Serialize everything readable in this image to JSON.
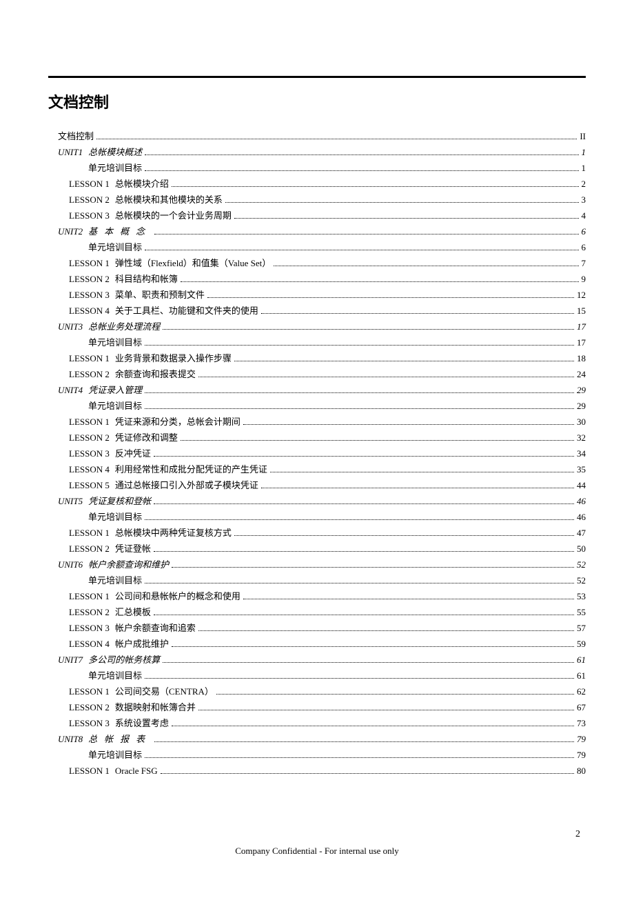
{
  "title": "文档控制",
  "footer": "Company Confidential - For internal use only",
  "page_number": "2",
  "toc": [
    {
      "level": 0,
      "label": "",
      "text": "文档控制",
      "page": "II"
    },
    {
      "level": 1,
      "label": "UNIT1",
      "text": "总帐模块概述",
      "page": "1"
    },
    {
      "level": 2,
      "label": "",
      "text": "单元培训目标",
      "page": "1"
    },
    {
      "level": 3,
      "label": "LESSON 1",
      "text": "总帐模块介绍",
      "page": "2"
    },
    {
      "level": 3,
      "label": "LESSON 2",
      "text": "总帐模块和其他模块的关系",
      "page": "3"
    },
    {
      "level": 3,
      "label": "LESSON 3",
      "text": "总帐模块的一个会计业务周期",
      "page": "4"
    },
    {
      "level": 1,
      "label": "UNIT2",
      "text": "基本概念",
      "page": "6",
      "spaced": true
    },
    {
      "level": 2,
      "label": "",
      "text": "单元培训目标",
      "page": "6"
    },
    {
      "level": 3,
      "label": "LESSON 1",
      "text": "弹性域（Flexfield）和值集（Value Set）",
      "page": "7"
    },
    {
      "level": 3,
      "label": "LESSON 2",
      "text": "科目结构和帐簿",
      "page": "9"
    },
    {
      "level": 3,
      "label": "LESSON 3",
      "text": "菜单、职责和预制文件",
      "page": "12"
    },
    {
      "level": 3,
      "label": "LESSON 4",
      "text": "关于工具栏、功能键和文件夹的使用",
      "page": "15"
    },
    {
      "level": 1,
      "label": "UNIT3",
      "text": "总帐业务处理流程",
      "page": "17"
    },
    {
      "level": 2,
      "label": "",
      "text": "单元培训目标",
      "page": "17"
    },
    {
      "level": 3,
      "label": "LESSON 1",
      "text": "业务背景和数据录入操作步骤",
      "page": "18"
    },
    {
      "level": 3,
      "label": "LESSON 2",
      "text": "余额查询和报表提交",
      "page": "24"
    },
    {
      "level": 1,
      "label": "UNIT4",
      "text": "凭证录入管理",
      "page": "29"
    },
    {
      "level": 2,
      "label": "",
      "text": "单元培训目标",
      "page": "29"
    },
    {
      "level": 3,
      "label": "LESSON 1",
      "text": "凭证来源和分类，总帐会计期间",
      "page": "30"
    },
    {
      "level": 3,
      "label": "LESSON 2",
      "text": "凭证修改和调整",
      "page": "32"
    },
    {
      "level": 3,
      "label": "LESSON 3",
      "text": "反冲凭证",
      "page": "34"
    },
    {
      "level": 3,
      "label": "LESSON 4",
      "text": "利用经常性和成批分配凭证的产生凭证",
      "page": "35"
    },
    {
      "level": 3,
      "label": "LESSON 5",
      "text": "通过总帐接口引入外部或子模块凭证",
      "page": "44"
    },
    {
      "level": 1,
      "label": "UNIT5",
      "text": "凭证复核和登帐",
      "page": "46"
    },
    {
      "level": 2,
      "label": "",
      "text": "单元培训目标",
      "page": "46"
    },
    {
      "level": 3,
      "label": "LESSON 1",
      "text": "总帐模块中两种凭证复核方式",
      "page": "47"
    },
    {
      "level": 3,
      "label": "LESSON 2",
      "text": "凭证登帐",
      "page": "50"
    },
    {
      "level": 1,
      "label": "UNIT6",
      "text": "帐户余额查询和维护",
      "page": "52"
    },
    {
      "level": 2,
      "label": "",
      "text": "单元培训目标",
      "page": "52"
    },
    {
      "level": 3,
      "label": "LESSON 1",
      "text": "公司间和悬帐帐户的概念和使用",
      "page": "53"
    },
    {
      "level": 3,
      "label": "LESSON 2",
      "text": "汇总模板",
      "page": "55"
    },
    {
      "level": 3,
      "label": "LESSON 3",
      "text": "帐户余额查询和追索",
      "page": "57"
    },
    {
      "level": 3,
      "label": "LESSON 4",
      "text": "帐户成批维护",
      "page": "59"
    },
    {
      "level": 1,
      "label": "UNIT7",
      "text": "多公司的帐务核算",
      "page": "61"
    },
    {
      "level": 2,
      "label": "",
      "text": "单元培训目标",
      "page": "61"
    },
    {
      "level": 3,
      "label": "LESSON 1",
      "text": "公司间交易（CENTRA）",
      "page": "62"
    },
    {
      "level": 3,
      "label": "LESSON 2",
      "text": "数据映射和帐簿合并",
      "page": "67"
    },
    {
      "level": 3,
      "label": "LESSON 3",
      "text": "系统设置考虑",
      "page": "73"
    },
    {
      "level": 1,
      "label": "UNIT8",
      "text": "总帐报表",
      "page": "79",
      "spaced": true
    },
    {
      "level": 2,
      "label": "",
      "text": "单元培训目标",
      "page": "79"
    },
    {
      "level": 3,
      "label": "LESSON 1",
      "text": "Oracle FSG",
      "page": "80"
    }
  ]
}
